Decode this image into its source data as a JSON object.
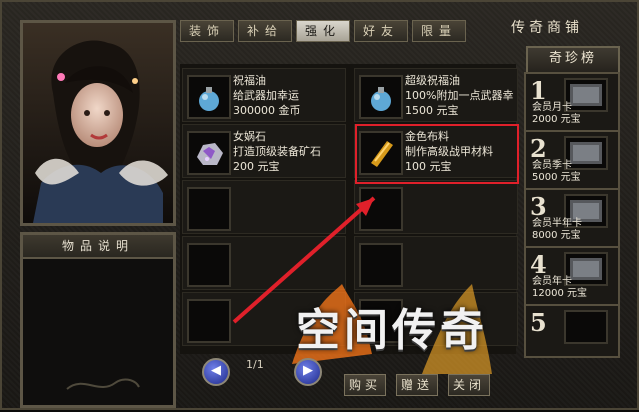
{
  "tabs": [
    {
      "label": "装饰"
    },
    {
      "label": "补给"
    },
    {
      "label": "强化",
      "active": true
    },
    {
      "label": "好友"
    },
    {
      "label": "限量"
    }
  ],
  "shop_title": "传奇商铺",
  "rank_title": "奇珍榜",
  "desc_title": "物品说明",
  "items": [
    {
      "name": "祝福油",
      "desc": "给武器加幸运",
      "price": "300000 金币",
      "icon": "blue-potion-icon"
    },
    {
      "name": "超级祝福油",
      "desc": "100%附加一点武器幸",
      "price": "1500 元宝",
      "icon": "blue-potion-icon"
    },
    {
      "name": "女娲石",
      "desc": "打造顶级装备矿石",
      "price": "200 元宝",
      "icon": "ore-icon"
    },
    {
      "name": "金色布料",
      "desc": "制作高级战甲材料",
      "price": "100 元宝",
      "icon": "cloth-icon"
    }
  ],
  "rank_items": [
    {
      "num": "1",
      "name": "会员月卡",
      "price": "2000 元宝"
    },
    {
      "num": "2",
      "name": "会员季卡",
      "price": "5000 元宝"
    },
    {
      "num": "3",
      "name": "会员半年卡",
      "price": "8000 元宝"
    },
    {
      "num": "4",
      "name": "会员年卡",
      "price": "12000 元宝"
    },
    {
      "num": "5",
      "name": "",
      "price": ""
    }
  ],
  "pager": "1/1",
  "buttons": {
    "buy": "购买",
    "gift": "赠送",
    "close": "关闭"
  },
  "logo": "空间传奇",
  "colors": {
    "highlight": "#e0202a",
    "arrow": "#e0202a"
  }
}
